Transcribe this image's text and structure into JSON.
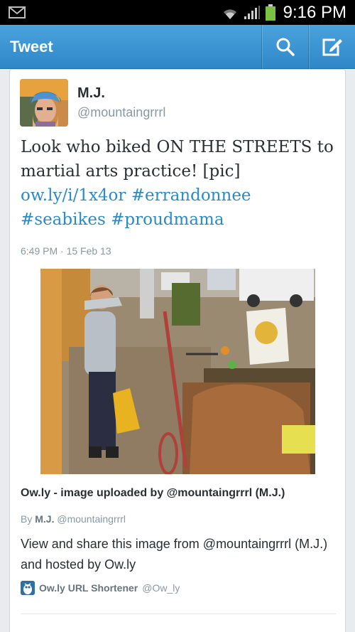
{
  "status_bar": {
    "time": "9:16 PM",
    "icons": [
      "mail-icon",
      "wifi-icon",
      "signal-icon",
      "battery-icon"
    ],
    "battery_color": "#7cc242"
  },
  "action_bar": {
    "title": "Tweet",
    "background": "#3a93d0",
    "actions": [
      "search-icon",
      "compose-icon"
    ]
  },
  "tweet": {
    "author": {
      "name": "M.J.",
      "handle": "@mountaingrrrl"
    },
    "text_parts": [
      "Look who biked ON THE STREETS to martial arts practice! [pic] ",
      "ow.ly/i/1x4or",
      " ",
      "#errandonnee",
      " ",
      "#seabikes",
      " ",
      "#proudmama"
    ],
    "link_color": "#2a8bc8",
    "timestamp": "6:49 PM · 15 Feb 13"
  },
  "media_card": {
    "title": "Ow.ly - image uploaded by @mountaingrrrl (M.J.)",
    "by_prefix": "By",
    "by_name": "M.J.",
    "by_handle": "@mountaingrrrl",
    "description": "View and share this image from @mountaingrrrl (M.J.) and hosted by Ow.ly",
    "site_name": "Ow.ly URL Shortener",
    "site_handle": "@Ow_ly"
  }
}
